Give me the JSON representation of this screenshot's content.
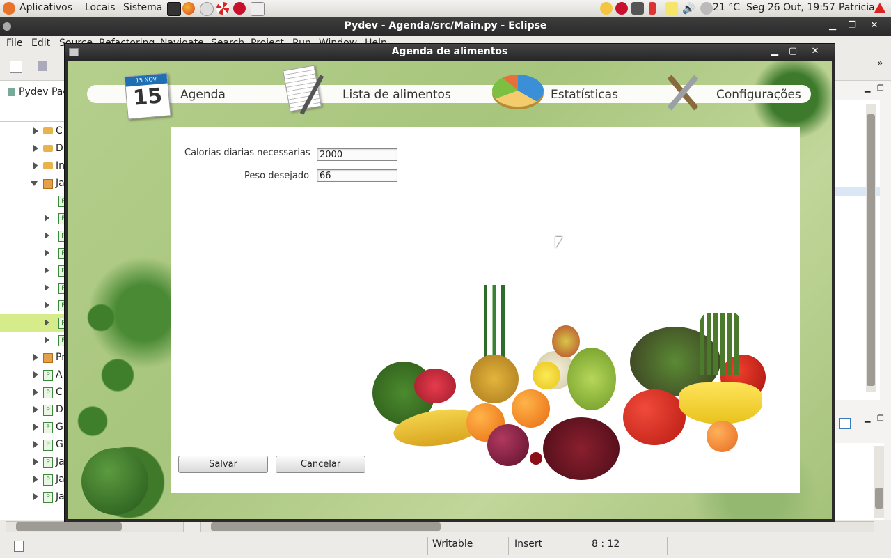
{
  "top_panel": {
    "menus": [
      "Aplicativos",
      "Locais",
      "Sistema"
    ],
    "weather": "21 °C",
    "datetime": "Seg 26 Out, 19:57",
    "user": "Patricia"
  },
  "eclipse": {
    "title": "Pydev - Agenda/src/Main.py - Eclipse",
    "menus": [
      "File",
      "Edit",
      "Source",
      "Refactoring",
      "Navigate",
      "Search",
      "Project",
      "Run",
      "Window",
      "Help"
    ],
    "package_explorer_tab": "Pydev Pac",
    "tree": [
      {
        "label": "C",
        "kind": "folder"
      },
      {
        "label": "D",
        "kind": "folder"
      },
      {
        "label": "In",
        "kind": "folder"
      },
      {
        "label": "Ja",
        "kind": "package"
      },
      {
        "label": "P",
        "kind": "file"
      },
      {
        "label": "P",
        "kind": "file"
      },
      {
        "label": "P",
        "kind": "file"
      },
      {
        "label": "P",
        "kind": "file"
      },
      {
        "label": "P",
        "kind": "file"
      },
      {
        "label": "P",
        "kind": "file"
      },
      {
        "label": "P",
        "kind": "file"
      },
      {
        "label": "P",
        "kind": "file"
      },
      {
        "label": "P",
        "kind": "file"
      },
      {
        "label": "Pr",
        "kind": "package"
      },
      {
        "label": "A",
        "kind": "file"
      },
      {
        "label": "C",
        "kind": "file"
      },
      {
        "label": "D",
        "kind": "file"
      },
      {
        "label": "G",
        "kind": "file"
      },
      {
        "label": "G",
        "kind": "file"
      },
      {
        "label": "Ja",
        "kind": "file"
      },
      {
        "label": "Ja",
        "kind": "file"
      },
      {
        "label": "Ja",
        "kind": "file"
      }
    ],
    "status": {
      "writable": "Writable",
      "insert": "Insert",
      "position": "8 : 12"
    }
  },
  "dialog": {
    "title": "Agenda de alimentos",
    "nav": [
      "Agenda",
      "Lista de alimentos",
      "Estatísticas",
      "Configurações"
    ],
    "calendar_month": "15 NOV",
    "calendar_day": "15",
    "fields": {
      "calories_label": "Calorias diarias necessarias",
      "calories_value": "2000",
      "weight_label": "Peso desejado",
      "weight_value": "66"
    },
    "buttons": {
      "save": "Salvar",
      "cancel": "Cancelar"
    }
  },
  "colors": {
    "panel_dark": "#2b2b2b",
    "accent_red": "#c8102e",
    "leaf_green": "#4a8a35"
  }
}
